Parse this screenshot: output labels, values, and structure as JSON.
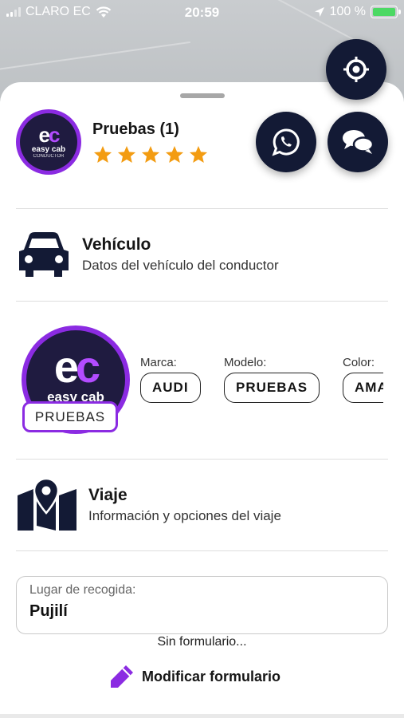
{
  "status_bar": {
    "carrier": "CLARO EC",
    "time": "20:59",
    "battery_percent": "100 %",
    "battery_level": 1.0
  },
  "driver": {
    "name": "Pruebas (1)",
    "rating": 5,
    "avatar_logo": {
      "mark": "ec",
      "name": "easy cab",
      "subtitle": "CONDUCTOR"
    }
  },
  "vehicle_section": {
    "title": "Vehículo",
    "subtitle": "Datos del vehículo del conductor"
  },
  "vehicle": {
    "logo_name": "easy cab",
    "plate": "PRUEBAS",
    "fields": [
      {
        "label": "Marca:",
        "value": "AUDI"
      },
      {
        "label": "Modelo:",
        "value": "PRUEBAS"
      },
      {
        "label": "Color:",
        "value": "AMARILLO"
      }
    ]
  },
  "trip_section": {
    "title": "Viaje",
    "subtitle": "Información y opciones del viaje"
  },
  "pickup": {
    "label": "Lugar de recogida:",
    "value": "Pujilí"
  },
  "form": {
    "status": "Sin formulario...",
    "modify_label": "Modificar formulario"
  },
  "colors": {
    "brand_purple": "#8b2be2",
    "button_navy": "#131a35",
    "star_orange": "#f39c12",
    "battery_green": "#4cd964"
  },
  "icons": [
    "signal-icon",
    "wifi-icon",
    "location-arrow-icon",
    "battery-icon",
    "crosshair-icon",
    "whatsapp-icon",
    "chat-bubbles-icon",
    "star-icon",
    "car-icon",
    "map-pin-icon",
    "pencil-icon"
  ]
}
